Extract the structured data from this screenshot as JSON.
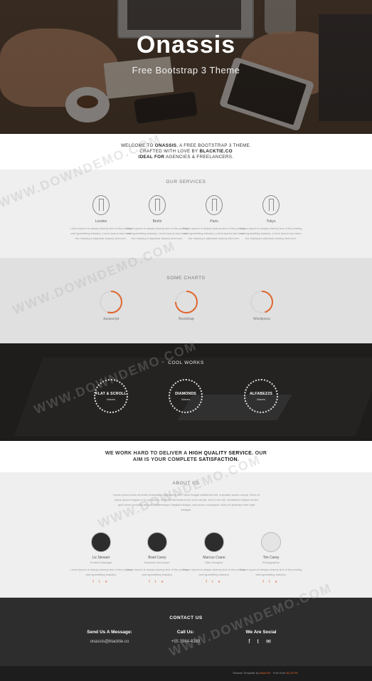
{
  "hero": {
    "title": "Onassis",
    "subtitle": "Free Bootstrap 3 Theme"
  },
  "welcome": {
    "line1_a": "WELCOME TO ",
    "line1_b": "ONASSIS",
    "line1_c": ", A FREE BOOTSTRAP 3 THEME.",
    "line2_a": "CRAFTED WITH LOVE BY ",
    "line2_b": "BLACKTIE.CO",
    "line3_a": "IDEAL FOR",
    "line3_b": " AGENCIES & FREELANCERS."
  },
  "services": {
    "title": "OUR SERVICES",
    "items": [
      {
        "city": "London",
        "text": "Lorem Ipsum is simply dummy text of the printing and typesetting industry. Lorem Ipsum has been the industry's standard dummy text ever."
      },
      {
        "city": "Berlin",
        "text": "Lorem Ipsum is simply dummy text of the printing and typesetting industry. Lorem Ipsum has been the industry's standard dummy text ever."
      },
      {
        "city": "Paris",
        "text": "Lorem Ipsum is simply dummy text of the printing and typesetting industry. Lorem Ipsum has been the industry's standard dummy text ever."
      },
      {
        "city": "Tokyo",
        "text": "Lorem Ipsum is simply dummy text of the printing and typesetting industry. Lorem Ipsum has been the industry's standard dummy text ever."
      }
    ]
  },
  "charts": {
    "title": "SOME CHARTS",
    "accent": "#e0662e",
    "items": [
      {
        "label": "Javascript",
        "value": 0.55
      },
      {
        "label": "Bootstrap",
        "value": 0.75
      },
      {
        "label": "Wordpress",
        "value": 0.45
      }
    ]
  },
  "works": {
    "title": "COOL WORKS",
    "items": [
      {
        "name": "FLAT & SCROLL",
        "sub": "Waves"
      },
      {
        "name": "DIAMONDS",
        "sub": "Waves"
      },
      {
        "name": "ALFABEZ2S",
        "sub": "Waves"
      }
    ]
  },
  "quote": {
    "a": "WE WORK HARD TO DELIVER A ",
    "b": "HIGH QUALITY SERVICE",
    "c": ". OUR",
    "d": "AIM IS YOUR COMPLETE ",
    "e": "SATISFACTION",
    "f": "."
  },
  "about": {
    "title": "ABOUT US",
    "text": "Lorem ipsum dolor sit amet consectetur adipiscing elit. Fusce feugiat sollicitudin elit, vulputate auctor neque. Nunc et turpis auctor magna ut in commodo. Vivamus elementum leo at mi iaculis, sed in est nisi. Vestibulum aliquet lectus quis lorem convallis tempor. Pellentesque fringilla tristique, sed purus consequat, nulla vel pharetra sem eget tristique."
  },
  "team": [
    {
      "name": "Liz Stewart",
      "role": "Product Manager",
      "bio": "Lorem Ipsum is simply dummy text of the printing and typesetting industry.",
      "social": "f t e"
    },
    {
      "name": "Brad Carey",
      "role": "Business Developer",
      "bio": "Lorem Ipsum is simply dummy text of the printing and typesetting industry.",
      "social": "f t e"
    },
    {
      "name": "Marcus Crane",
      "role": "Web Designer",
      "bio": "Lorem Ipsum is simply dummy text of the printing and typesetting industry.",
      "social": "f t e"
    },
    {
      "name": "Tim Carey",
      "role": "Photographer",
      "bio": "Lorem Ipsum is simply dummy text of the printing and typesetting industry.",
      "social": "f t e"
    }
  ],
  "contact": {
    "title": "CONTACT US",
    "message_label": "Send Us A Message:",
    "email": "onassis@blacktie.co",
    "call_label": "Call Us:",
    "phone": "+55 3984-4389",
    "social_label": "We Are Social",
    "social_icons": "f t ✉"
  },
  "footer": {
    "prefix": "Onassis Template by ",
    "link1": "BlackTie",
    "mid": " · Free from ",
    "link2": "BLCKTIE"
  },
  "watermark": "WWW.DOWNDEMO.COM"
}
